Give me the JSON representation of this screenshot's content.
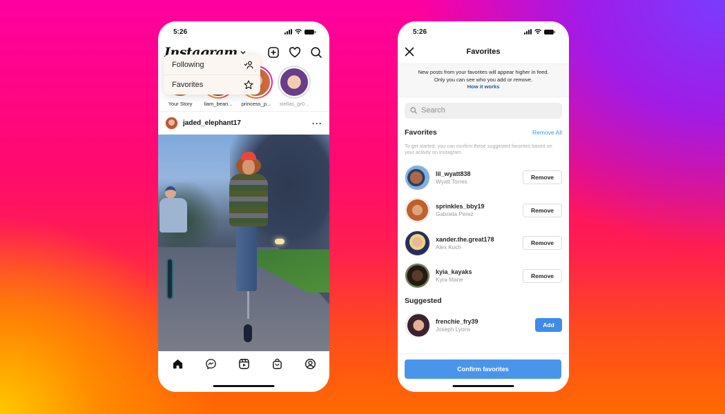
{
  "colors": {
    "accent_blue": "#3d8ce8",
    "link_blue": "#3897f0",
    "how_it_works": "#2a5a8c",
    "dropdown_bg": "#fbf6f1"
  },
  "feed_phone": {
    "status_time": "5:26",
    "app_logo": "Instagram",
    "header_icons": [
      "new-post-icon",
      "heart-icon",
      "search-icon"
    ],
    "dropdown": {
      "items": [
        {
          "label": "Following",
          "icon": "following-icon"
        },
        {
          "label": "Favorites",
          "icon": "star-icon"
        }
      ]
    },
    "stories": [
      {
        "label": "Your Story",
        "state": "own"
      },
      {
        "label": "liam_bean...",
        "state": "unseen"
      },
      {
        "label": "princess_p...",
        "state": "unseen"
      },
      {
        "label": "stellas_gr0...",
        "state": "seen"
      }
    ],
    "post": {
      "username": "jaded_elephant17",
      "more_icon": "more-icon"
    },
    "tabbar": [
      "home-icon",
      "messenger-icon",
      "reels-icon",
      "shop-icon",
      "profile-icon"
    ]
  },
  "favorites_phone": {
    "status_time": "5:26",
    "title": "Favorites",
    "notice_line1": "New posts from your favorites will appear higher in feed.",
    "notice_line2": "Only you can see who you add or remove.",
    "notice_link": "How it works",
    "search_placeholder": "Search",
    "favorites_section": {
      "title": "Favorites",
      "action": "Remove All",
      "description": "To get started, you can confirm these suggested favorites based on your activity on Instagram."
    },
    "favorites": [
      {
        "handle": "lil_wyatt838",
        "name": "Wyatt Torres",
        "button": "Remove"
      },
      {
        "handle": "sprinkles_bby19",
        "name": "Gabriela Perez",
        "button": "Remove"
      },
      {
        "handle": "xander.the.great178",
        "name": "Alex Koch",
        "button": "Remove"
      },
      {
        "handle": "kyia_kayaks",
        "name": "Kyra Marie",
        "button": "Remove"
      }
    ],
    "suggested_section": {
      "title": "Suggested"
    },
    "suggested": [
      {
        "handle": "frenchie_fry39",
        "name": "Joseph Lyons",
        "button": "Add"
      }
    ],
    "confirm_button": "Confirm favorites"
  }
}
